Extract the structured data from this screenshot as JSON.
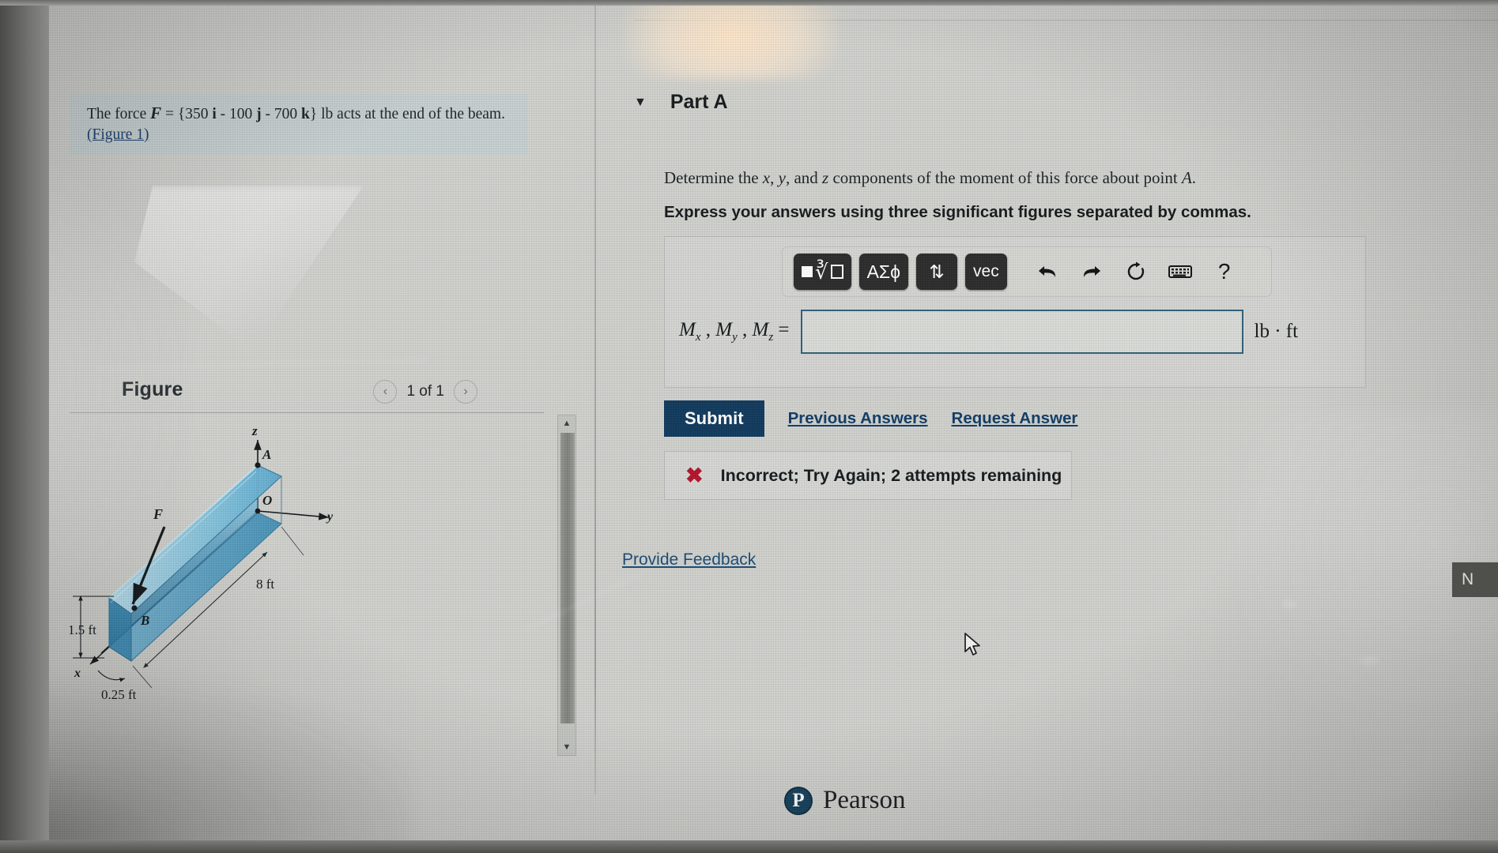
{
  "problem": {
    "text_before": "The force ",
    "force_symbol": "F",
    "equals": " = {350 ",
    "i": "i",
    "minus1": " - 100 ",
    "j": "j",
    "minus2": " - 700 ",
    "k": "k",
    "unit_tail": "} lb acts at the end of the beam. ",
    "figure_link": "(Figure 1)",
    "full_text": "The force F = {350 i - 100 j - 700 k} lb acts at the end of the beam. (Figure 1)"
  },
  "figure": {
    "title": "Figure",
    "prev_label": "‹",
    "next_label": "›",
    "counter": "1 of 1",
    "scroll_up": "▲",
    "scroll_down": "▼",
    "labels": {
      "z_axis": "z",
      "y_axis": "y",
      "x_axis": "x",
      "point_A": "A",
      "point_O": "O",
      "point_B": "B",
      "force": "F",
      "length_8ft": "8 ft",
      "height_1_5ft": "1.5 ft",
      "width_0_25ft": "0.25 ft"
    },
    "beam_color": "#5aa8cd",
    "beam_color_dark": "#2f7ea8"
  },
  "part_a": {
    "caret": "▼",
    "title": "Part A",
    "question_prefix": "Determine the ",
    "var_x": "x",
    "sep1": ", ",
    "var_y": "y",
    "sep2": ", and ",
    "var_z": "z",
    "question_suffix": " components of the moment of this force about point ",
    "point": "A",
    "question_full": "Determine the x, y, and z components of the moment of this force about point A.",
    "instruction": "Express your answers using three significant figures separated by commas."
  },
  "toolbar": {
    "template_key": "■ⁿ√□",
    "greek_key": "ΑΣϕ",
    "updown_key": "⇅",
    "vec_key": "vec",
    "undo_icon": "undo-icon",
    "redo_icon": "redo-icon",
    "reset_icon": "reset-icon",
    "keyboard_icon": "keyboard-icon",
    "help_icon": "?"
  },
  "answer": {
    "label_M": "M",
    "sub_x": "x",
    "sub_y": "y",
    "sub_z": "z",
    "label_full": "Mₓ , Mᵧ , M_z =",
    "value": "",
    "placeholder": "",
    "unit": "lb · ft"
  },
  "actions": {
    "submit": "Submit",
    "previous_answers": "Previous Answers",
    "request_answer": "Request Answer",
    "provide_feedback": "Provide Feedback"
  },
  "feedback": {
    "icon": "✖",
    "message": "Incorrect; Try Again; 2 attempts remaining",
    "color": "#b4122b"
  },
  "footer": {
    "brand_mark": "P",
    "brand_name": "Pearson"
  },
  "edge": {
    "partial_label": "N"
  },
  "colors": {
    "submit_bg": "#10395c",
    "link": "#0f3b66",
    "error": "#b4122b",
    "input_border": "#2f5f7a",
    "problem_box_bg": "#c6cfd0"
  }
}
